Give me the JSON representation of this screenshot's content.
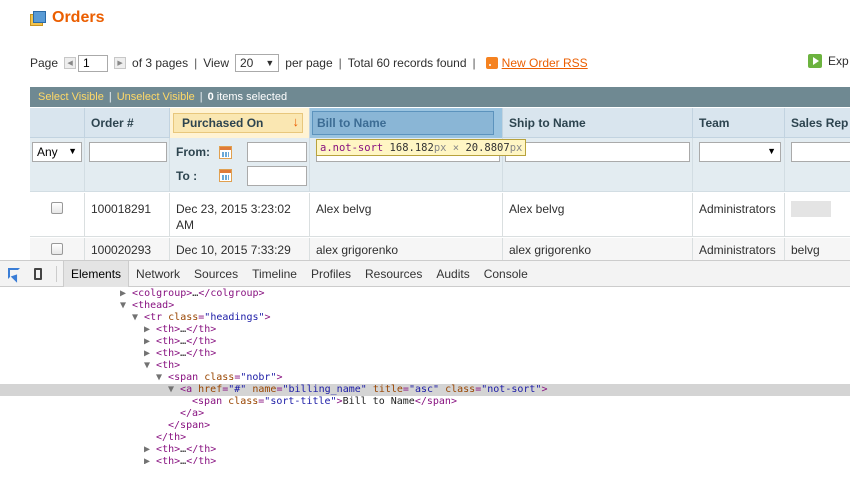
{
  "header": {
    "title": "Orders"
  },
  "pager": {
    "page_label": "Page",
    "page_value": "1",
    "of_pages": "of 3 pages",
    "sep": "|",
    "view_label": "View",
    "view_value": "20",
    "per_page": "per page",
    "total": "Total 60 records found",
    "rss_label": "New Order RSS",
    "export_label": "Exp"
  },
  "massaction": {
    "select_visible": "Select Visible",
    "unselect_visible": "Unselect Visible",
    "count": "0",
    "selected_label": "items selected"
  },
  "grid": {
    "headings": [
      "Order #",
      "Purchased On",
      "Bill to Name",
      "Ship to Name",
      "Team",
      "Sales Rep"
    ],
    "sort_arrow": "↓",
    "filter": {
      "any_value": "Any",
      "from_label": "From:",
      "to_label": "To :"
    },
    "rows": [
      {
        "order": "100018291",
        "purchased": "Dec 23, 2015 3:23:02 AM",
        "bill": "Alex belvg",
        "ship": "Alex belvg",
        "team": "Administrators",
        "rep": ""
      },
      {
        "order": "100020293",
        "purchased": "Dec 10, 2015 7:33:29",
        "bill": "alex grigorenko",
        "ship": "alex grigorenko",
        "team": "Administrators",
        "rep": "belvg"
      }
    ]
  },
  "tooltip": {
    "selector": "a.not-sort",
    "width": "168.182",
    "unit": "px",
    "times": "×",
    "height": "20.8807"
  },
  "devtools": {
    "tabs": [
      "Elements",
      "Network",
      "Sources",
      "Timeline",
      "Profiles",
      "Resources",
      "Audits",
      "Console"
    ],
    "tree": [
      "colgroup_line",
      "thead_open",
      "tr_open",
      "th1",
      "th2",
      "th3",
      "th_open",
      "span_open",
      "a_open",
      "span_inner",
      "a_close",
      "span_close",
      "th_close",
      "th5",
      "th6"
    ],
    "text": {
      "colgroup": "colgroup",
      "ellipsis": "…",
      "thead": "thead",
      "tr": "tr",
      "th": "th",
      "span": "span",
      "a": "a",
      "attr_class": "class",
      "val_headings": "\"headings\"",
      "val_nobr": "\"nobr\"",
      "attr_href": "href",
      "val_href": "\"#\"",
      "attr_name": "name",
      "val_name": "\"billing_name\"",
      "attr_title": "title",
      "val_title": "\"asc\"",
      "val_notsort": "\"not-sort\"",
      "val_sorttitle": "\"sort-title\"",
      "inner_text": "Bill to Name"
    }
  }
}
